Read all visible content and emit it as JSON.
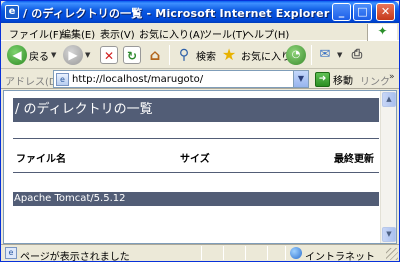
{
  "window": {
    "title": "/ のディレクトリの一覧 - Microsoft Internet Explorer",
    "minimize": "_",
    "maximize": "□",
    "close": "✕"
  },
  "menu": {
    "items": [
      {
        "label": "ファイル(F)"
      },
      {
        "label": "編集(E)"
      },
      {
        "label": "表示(V)"
      },
      {
        "label": "お気に入り(A)"
      },
      {
        "label": "ツール(T)"
      },
      {
        "label": "ヘルプ(H)"
      }
    ]
  },
  "toolbar": {
    "back": {
      "label": "戻る",
      "icon": "back-arrow-icon"
    },
    "forward": {
      "icon": "forward-arrow-icon"
    },
    "stop": {
      "icon": "stop-icon"
    },
    "refresh": {
      "icon": "refresh-icon"
    },
    "home": {
      "icon": "home-icon"
    },
    "search": {
      "label": "検索",
      "icon": "search-icon"
    },
    "favorites": {
      "label": "お気に入り",
      "icon": "star-icon"
    },
    "history": {
      "icon": "history-icon"
    },
    "mail": {
      "icon": "mail-icon"
    },
    "print": {
      "icon": "print-icon"
    }
  },
  "address": {
    "label": "アドレス(D)",
    "url": "http://localhost/marugoto/",
    "go_label": "移動",
    "links_label": "リンク"
  },
  "content": {
    "heading": "/ のディレクトリの一覧",
    "columns": {
      "name": "ファイル名",
      "size": "サイズ",
      "modified": "最終更新"
    },
    "footer": "Apache Tomcat/5.5.12"
  },
  "status": {
    "text": "ページが表示されました",
    "zone": "イントラネット"
  }
}
